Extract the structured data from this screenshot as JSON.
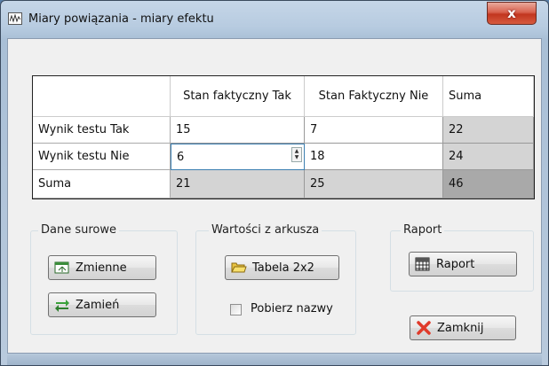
{
  "window": {
    "title": "Miary powiązania - miary efektu",
    "close_label": "x"
  },
  "table": {
    "columns": [
      "",
      "Stan faktyczny Tak",
      "Stan Faktyczny Nie",
      "Suma"
    ],
    "rows": [
      {
        "label": "Wynik testu Tak",
        "c1": "15",
        "c2": "7",
        "sum": "22"
      },
      {
        "label": "Wynik testu Nie",
        "c1": "6",
        "c2": "18",
        "sum": "24"
      },
      {
        "label": "Suma",
        "c1": "21",
        "c2": "25",
        "sum": "46"
      }
    ]
  },
  "groups": {
    "raw": {
      "label": "Dane surowe",
      "variables_button": "Zmienne",
      "swap_button": "Zamień"
    },
    "sheet": {
      "label": "Wartości z arkusza",
      "table_button": "Tabela 2x2",
      "fetch_names_label": "Pobierz nazwy",
      "fetch_names_checked": false
    },
    "report": {
      "label": "Raport",
      "report_button": "Raport"
    }
  },
  "close_button": "Zamknij"
}
